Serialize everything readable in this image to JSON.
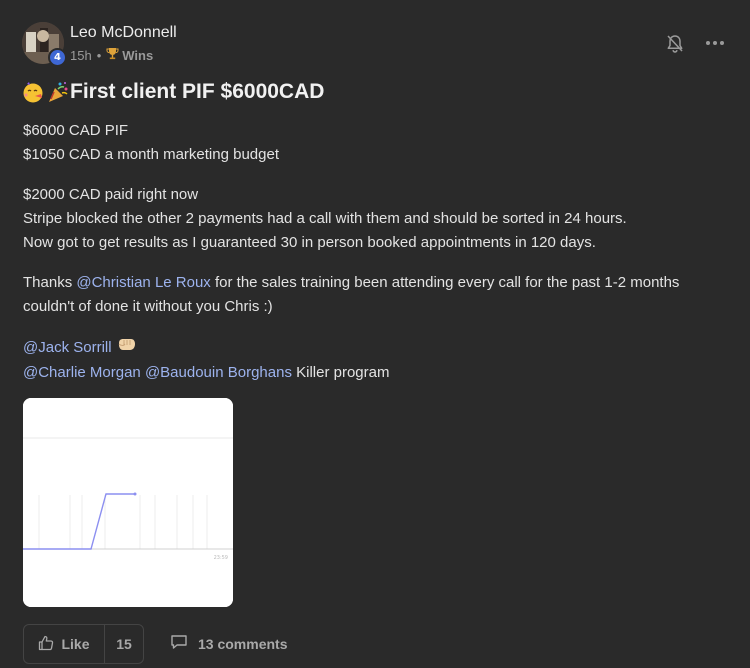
{
  "author": {
    "name": "Leo McDonnell",
    "level": "4",
    "time": "15h",
    "separator": "•",
    "category": "Wins",
    "category_icon": "trophy-icon"
  },
  "post": {
    "title": "First client PIF $6000CAD",
    "title_emojis": [
      "face-with-party-horn-icon",
      "party-popper-icon"
    ],
    "paragraphs": [
      [
        "$6000 CAD PIF",
        "$1050 CAD a month marketing budget"
      ],
      [
        "$2000 CAD paid right now",
        "Stripe blocked the other 2 payments had a call with them and should be sorted in 24 hours.",
        "Now got to get results as I guaranteed 30 in person booked appointments in 120 days."
      ]
    ],
    "thanks": {
      "prefix": "Thanks ",
      "mention": "@Christian Le Roux",
      "line1_rest": " for the sales training been attending every call for the past 1-2 months",
      "line2": "couldn't of done it without you Chris :)"
    },
    "mentions_block": {
      "line1_mention": "@Jack Sorrill",
      "line1_emoji": "fist-bump-icon",
      "line2_mention1": "@Charlie Morgan",
      "line2_mention2": "@Baudouin Borghans",
      "line2_rest": " Killer program"
    },
    "image": {
      "icon": "chart-screenshot-thumbnail",
      "tick_label": "23:59"
    }
  },
  "footer": {
    "like_label": "Like",
    "like_count": "15",
    "comments_label": "13 comments"
  },
  "colors": {
    "background": "#2a2a2a",
    "mention": "#9db3ee",
    "badge": "#3e67d4"
  }
}
